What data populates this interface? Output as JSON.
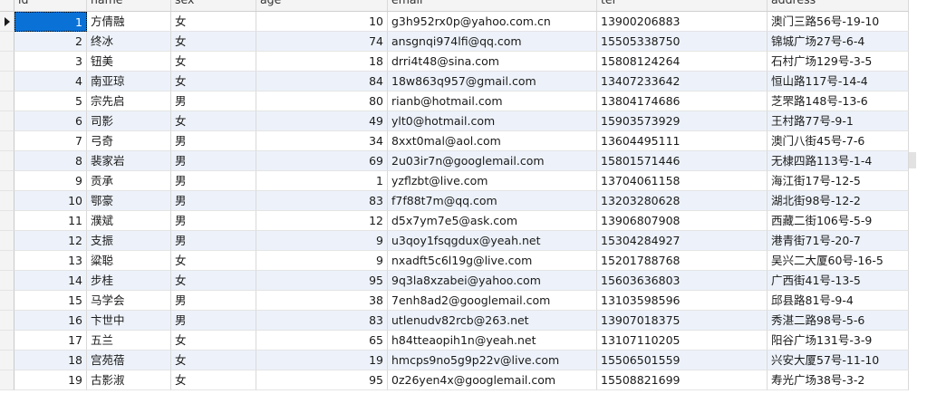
{
  "columns": {
    "id": "id",
    "name": "name",
    "sex": "sex",
    "age": "age",
    "email": "email",
    "tel": "tel",
    "address": "address"
  },
  "selected_row": 1,
  "rows": [
    {
      "id": "1",
      "name": "方倩融",
      "sex": "女",
      "age": "10",
      "email": "g3h952rx0p@yahoo.com.cn",
      "tel": "13900206883",
      "address": "澳门三路56号-19-10"
    },
    {
      "id": "2",
      "name": "终冰",
      "sex": "女",
      "age": "74",
      "email": "ansgnqi974lfi@qq.com",
      "tel": "15505338750",
      "address": "锦城广场27号-6-4"
    },
    {
      "id": "3",
      "name": "钮美",
      "sex": "女",
      "age": "18",
      "email": "drri4t48@sina.com",
      "tel": "15808124264",
      "address": "石村广场129号-3-5"
    },
    {
      "id": "4",
      "name": "南亚琼",
      "sex": "女",
      "age": "84",
      "email": "18w863q957@gmail.com",
      "tel": "13407233642",
      "address": "恒山路117号-14-4"
    },
    {
      "id": "5",
      "name": "宗先启",
      "sex": "男",
      "age": "80",
      "email": "rianb@hotmail.com",
      "tel": "13804174686",
      "address": "芝罘路148号-13-6"
    },
    {
      "id": "6",
      "name": "司影",
      "sex": "女",
      "age": "49",
      "email": "ylt0@hotmail.com",
      "tel": "15903573929",
      "address": "王村路77号-9-1"
    },
    {
      "id": "7",
      "name": "弓奇",
      "sex": "男",
      "age": "34",
      "email": "8xxt0mal@aol.com",
      "tel": "13604495111",
      "address": "澳门八街45号-7-6"
    },
    {
      "id": "8",
      "name": "裴家岩",
      "sex": "男",
      "age": "69",
      "email": "2u03ir7n@googlemail.com",
      "tel": "15801571446",
      "address": "无棣四路113号-1-4"
    },
    {
      "id": "9",
      "name": "贡承",
      "sex": "男",
      "age": "1",
      "email": "yzflzbt@live.com",
      "tel": "13704061158",
      "address": "海江街17号-12-5"
    },
    {
      "id": "10",
      "name": "鄂豪",
      "sex": "男",
      "age": "83",
      "email": "f7f88t7m@qq.com",
      "tel": "13203280628",
      "address": "湖北街98号-12-2"
    },
    {
      "id": "11",
      "name": "濮斌",
      "sex": "男",
      "age": "12",
      "email": "d5x7ym7e5@ask.com",
      "tel": "13906807908",
      "address": "西藏二街106号-5-9"
    },
    {
      "id": "12",
      "name": "支振",
      "sex": "男",
      "age": "9",
      "email": "u3qoy1fsqgdux@yeah.net",
      "tel": "15304284927",
      "address": "港青街71号-20-7"
    },
    {
      "id": "13",
      "name": "粱聪",
      "sex": "女",
      "age": "9",
      "email": "nxadft5c6l19g@live.com",
      "tel": "15201788768",
      "address": "吴兴二大厦60号-16-5"
    },
    {
      "id": "14",
      "name": "步桂",
      "sex": "女",
      "age": "95",
      "email": "9q3la8xzabei@yahoo.com",
      "tel": "15603636803",
      "address": "广西街41号-13-5"
    },
    {
      "id": "15",
      "name": "马学会",
      "sex": "男",
      "age": "38",
      "email": "7enh8ad2@googlemail.com",
      "tel": "13103598596",
      "address": "邱县路81号-9-4"
    },
    {
      "id": "16",
      "name": "卞世中",
      "sex": "男",
      "age": "83",
      "email": "utlenudv82rcb@263.net",
      "tel": "13907018375",
      "address": "秀湛二路98号-5-6"
    },
    {
      "id": "17",
      "name": "五兰",
      "sex": "女",
      "age": "65",
      "email": "h84tteaopih1n@yeah.net",
      "tel": "13107110205",
      "address": "阳谷广场131号-3-9"
    },
    {
      "id": "18",
      "name": "宫苑蓓",
      "sex": "女",
      "age": "19",
      "email": "hmcps9no5g9p22v@live.com",
      "tel": "15506501559",
      "address": "兴安大厦57号-11-10"
    },
    {
      "id": "19",
      "name": "古影淑",
      "sex": "女",
      "age": "95",
      "email": "0z26yen4x@googlemail.com",
      "tel": "15508821699",
      "address": "寿光广场38号-3-2"
    }
  ]
}
